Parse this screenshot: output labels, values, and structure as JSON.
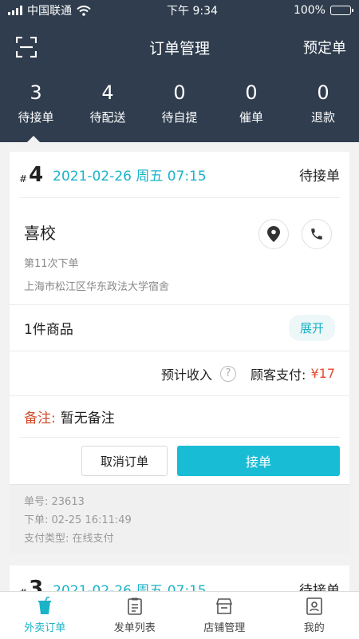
{
  "status_bar": {
    "carrier": "中国联通",
    "time": "下午 9:34",
    "battery": "100%"
  },
  "nav": {
    "title": "订单管理",
    "right_label": "预定单"
  },
  "stats": [
    {
      "count": "3",
      "label": "待接单"
    },
    {
      "count": "4",
      "label": "待配送"
    },
    {
      "count": "0",
      "label": "待自提"
    },
    {
      "count": "0",
      "label": "催单"
    },
    {
      "count": "0",
      "label": "退款"
    }
  ],
  "orders": [
    {
      "hash": "#",
      "number": "4",
      "datetime": "2021-02-26 周五 07:15",
      "status": "待接单",
      "customer_name": "喜校",
      "order_count": "第11次下单",
      "address": "上海市松江区华东政法大学宿舍",
      "goods_count": "1件商品",
      "expand_label": "展开",
      "income_label": "预计收入",
      "payment_label": "顾客支付:",
      "payment_amount": "¥17",
      "remark_label": "备注:",
      "remark_text": "暂无备注",
      "cancel_label": "取消订单",
      "accept_label": "接单",
      "order_id": "单号: 23613",
      "placed_at": "下单: 02-25 16:11:49",
      "payment_type": "支付类型: 在线支付"
    },
    {
      "hash": "#",
      "number": "3",
      "datetime": "2021-02-26 周五 07:15",
      "status": "待接单"
    }
  ],
  "tabs": [
    {
      "label": "外卖订单",
      "icon": "takeout-cup-icon",
      "active": true
    },
    {
      "label": "发单列表",
      "icon": "clipboard-list-icon",
      "active": false
    },
    {
      "label": "店铺管理",
      "icon": "store-icon",
      "active": false
    },
    {
      "label": "我的",
      "icon": "profile-card-icon",
      "active": false
    }
  ],
  "colors": {
    "header_bg": "#2f3d4e",
    "accent": "#18bcd4",
    "price": "#e54a2c",
    "remark": "#d24b2a"
  }
}
